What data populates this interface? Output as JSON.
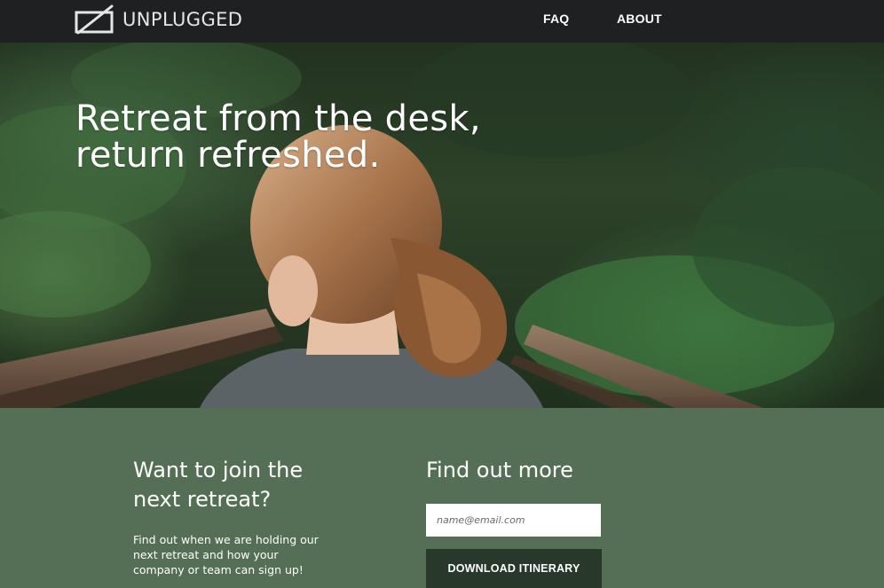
{
  "header": {
    "brand": "UNPLUGGED",
    "nav": [
      {
        "label": "FAQ"
      },
      {
        "label": "ABOUT"
      }
    ]
  },
  "hero": {
    "title_lines": [
      "Retreat from the desk,",
      "return refreshed."
    ],
    "image_icon": "photo-woman-on-forest-bridge"
  },
  "signup": {
    "join_heading_lines": [
      "Want to join the",
      "next retreat?"
    ],
    "join_text": "Find out when we are holding our next retreat and how your company or team can sign up!",
    "more_heading": "Find out more",
    "email_placeholder": "name@email.com",
    "download_label": "DOWNLOAD ITINERARY"
  },
  "colors": {
    "topbar": "#1f2021",
    "section_bg": "#546f55",
    "button_bg": "#28392b",
    "text": "#ffffff"
  }
}
